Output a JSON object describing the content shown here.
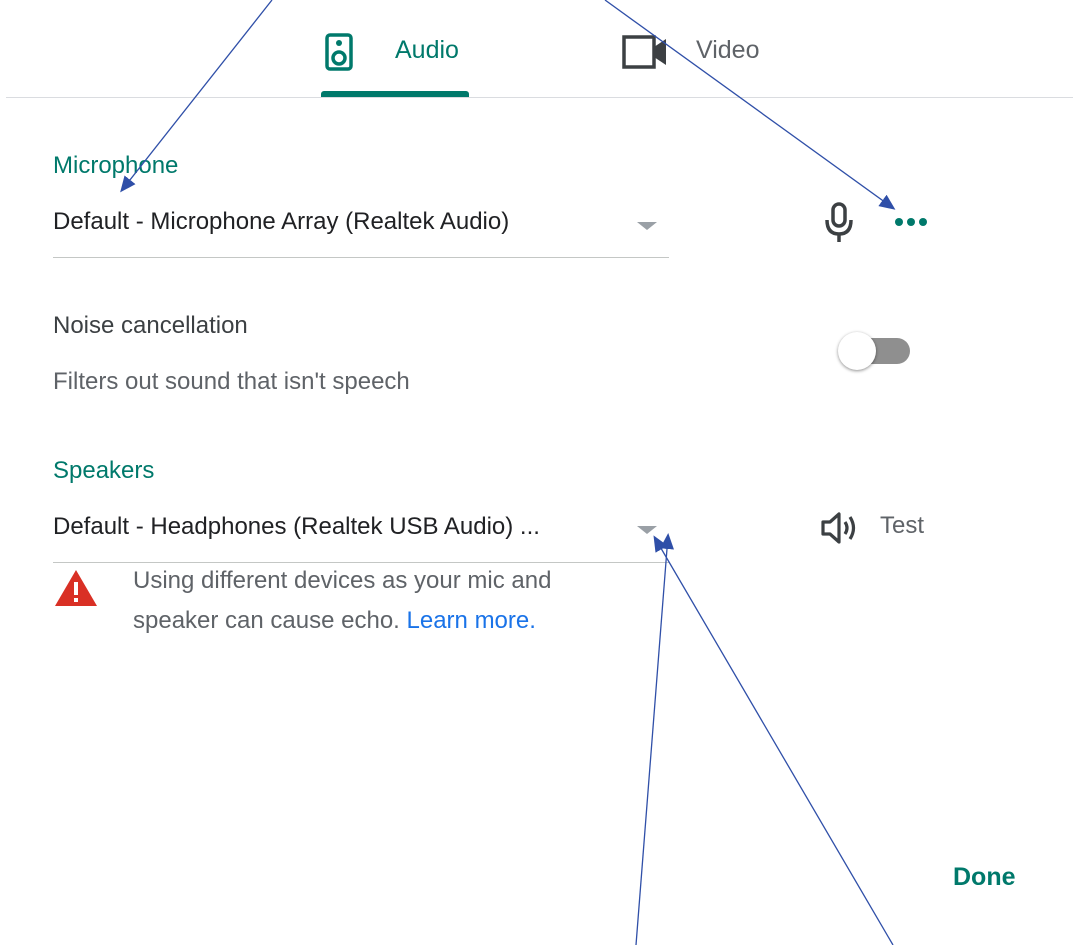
{
  "tabs": [
    {
      "label": "Audio",
      "icon": "speaker-icon",
      "active": true
    },
    {
      "label": "Video",
      "icon": "video-camera-icon",
      "active": false
    }
  ],
  "microphone": {
    "title": "Microphone",
    "device": "Default - Microphone Array (Realtek Audio)",
    "icons": [
      "microphone-icon",
      "more-options-icon"
    ]
  },
  "noise_cancellation": {
    "title": "Noise cancellation",
    "description": "Filters out sound that isn't speech",
    "enabled": false
  },
  "speakers": {
    "title": "Speakers",
    "device": "Default - Headphones (Realtek USB Audio) ...",
    "test_label": "Test",
    "warning": {
      "text": "Using different devices as your mic and speaker can cause echo.",
      "link": "Learn more."
    }
  },
  "footer": {
    "done_label": "Done"
  },
  "colors": {
    "accent": "#00796b",
    "warning": "#d93025",
    "link": "#1a73e8",
    "annotation_arrow": "#2f4fa8"
  }
}
